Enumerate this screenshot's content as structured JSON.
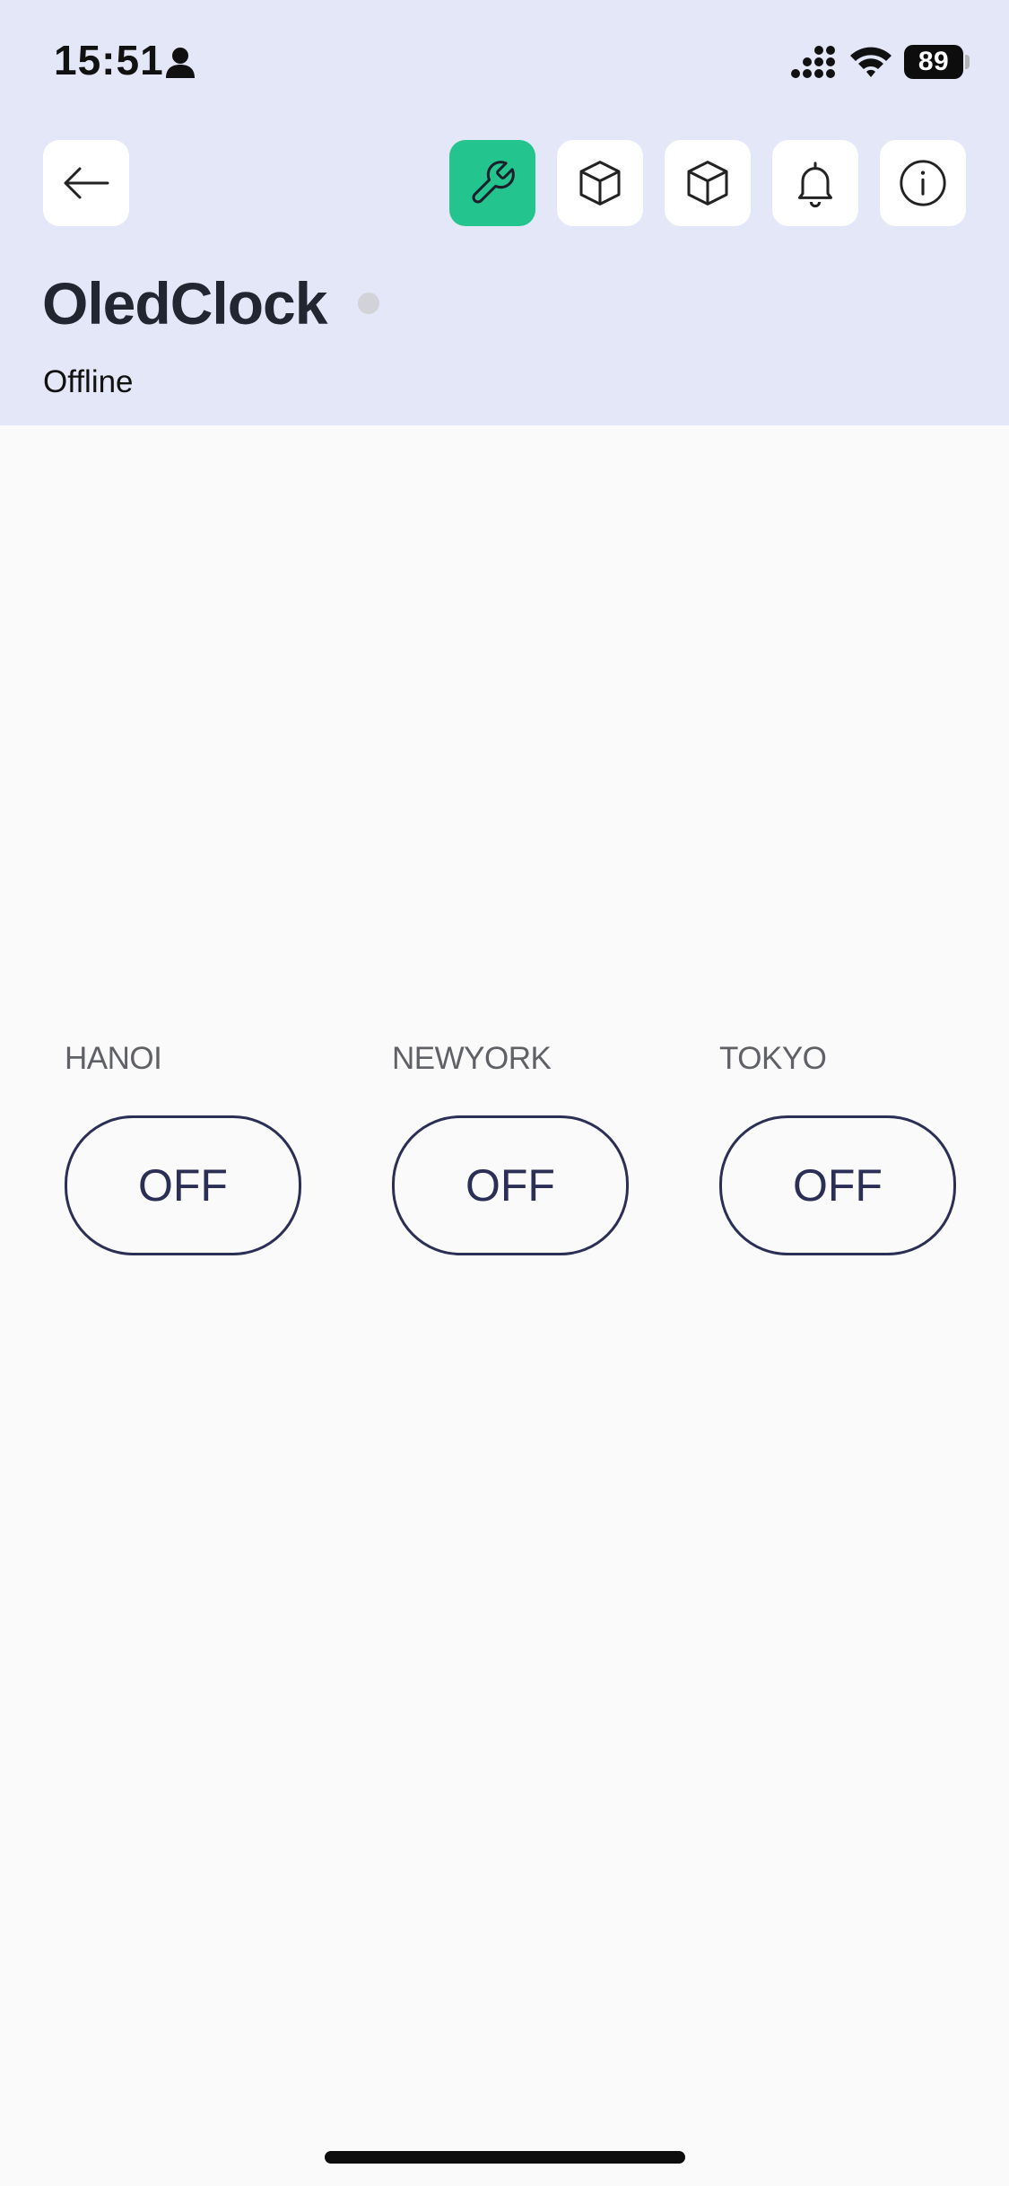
{
  "status_bar": {
    "time": "15:51",
    "battery": "89"
  },
  "toolbar": {
    "back_icon": "arrow-left-icon",
    "buttons": [
      {
        "icon": "wrench-icon",
        "active": true
      },
      {
        "icon": "cube-icon",
        "active": false
      },
      {
        "icon": "cube-icon",
        "active": false
      },
      {
        "icon": "bell-icon",
        "active": false
      },
      {
        "icon": "info-icon",
        "active": false
      }
    ],
    "accent_color": "#23c48e"
  },
  "device": {
    "name": "OledClock",
    "status": "Offline",
    "status_dot_color": "#d2d3d8"
  },
  "widgets": [
    {
      "label": "HANOI",
      "value": "OFF"
    },
    {
      "label": "NEWYORK",
      "value": "OFF"
    },
    {
      "label": "TOKYO",
      "value": "OFF"
    }
  ],
  "colors": {
    "header_bg": "#e3e7f7",
    "page_bg": "#fafafa",
    "switch_color": "#2b2e55"
  }
}
